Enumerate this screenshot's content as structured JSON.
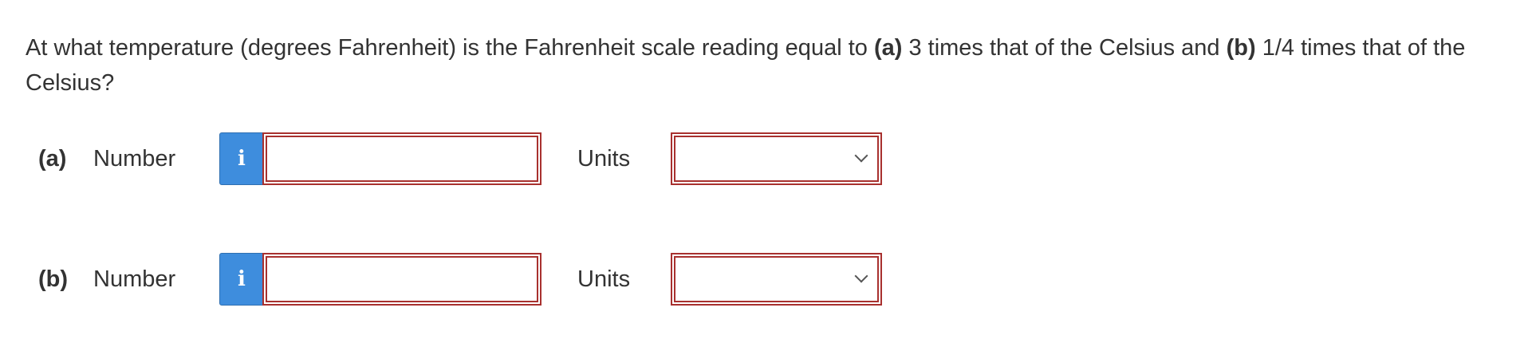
{
  "question": {
    "prefix": "At what temperature (degrees Fahrenheit) is the Fahrenheit scale reading equal to ",
    "part_a_marker": "(a)",
    "part_a_text": " 3 times that of the Celsius and ",
    "part_b_marker": "(b)",
    "part_b_text": " 1/4 times that of the Celsius?"
  },
  "parts": [
    {
      "label": "(a)",
      "number_label": "Number",
      "info_icon": "i",
      "number_value": "",
      "units_label": "Units",
      "units_selected": ""
    },
    {
      "label": "(b)",
      "number_label": "Number",
      "info_icon": "i",
      "number_value": "",
      "units_label": "Units",
      "units_selected": ""
    }
  ],
  "colors": {
    "info_button": "#3e8ddd",
    "error_border": "#a8312f"
  }
}
